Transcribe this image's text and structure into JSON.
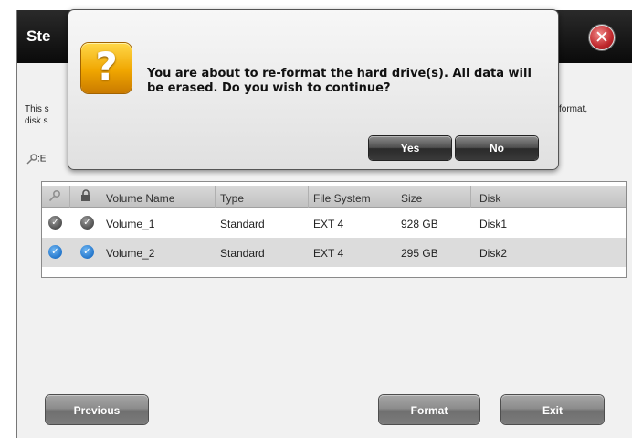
{
  "wizard": {
    "title": "Ste",
    "description_left": "This s\ndisk s",
    "description_right": "format,",
    "legend_text": ":E"
  },
  "grid": {
    "columns": [
      "Volume Name",
      "Type",
      "File System",
      "Size",
      "Disk"
    ],
    "rows": [
      {
        "volume_name": "Volume_1",
        "type": "Standard",
        "file_system": "EXT 4",
        "size": "928 GB",
        "disk": "Disk1",
        "selected": false
      },
      {
        "volume_name": "Volume_2",
        "type": "Standard",
        "file_system": "EXT 4",
        "size": "295 GB",
        "disk": "Disk2",
        "selected": true
      }
    ]
  },
  "buttons": {
    "previous": "Previous",
    "format": "Format",
    "exit": "Exit"
  },
  "dialog": {
    "icon_glyph": "?",
    "message": "You are about to re-format the hard drive(s). All data will be erased. Do you wish to continue?",
    "yes": "Yes",
    "no": "No"
  },
  "icons": {
    "close": "close-icon",
    "question": "question-icon",
    "key": "key-icon",
    "lock": "lock-icon",
    "check": "check-icon"
  },
  "colors": {
    "titlebar": "#111111",
    "close_red": "#c0282c",
    "question_yellow": "#f0a600",
    "selected_blue": "#1f72c8",
    "row_highlight": "#dcdcdc"
  }
}
